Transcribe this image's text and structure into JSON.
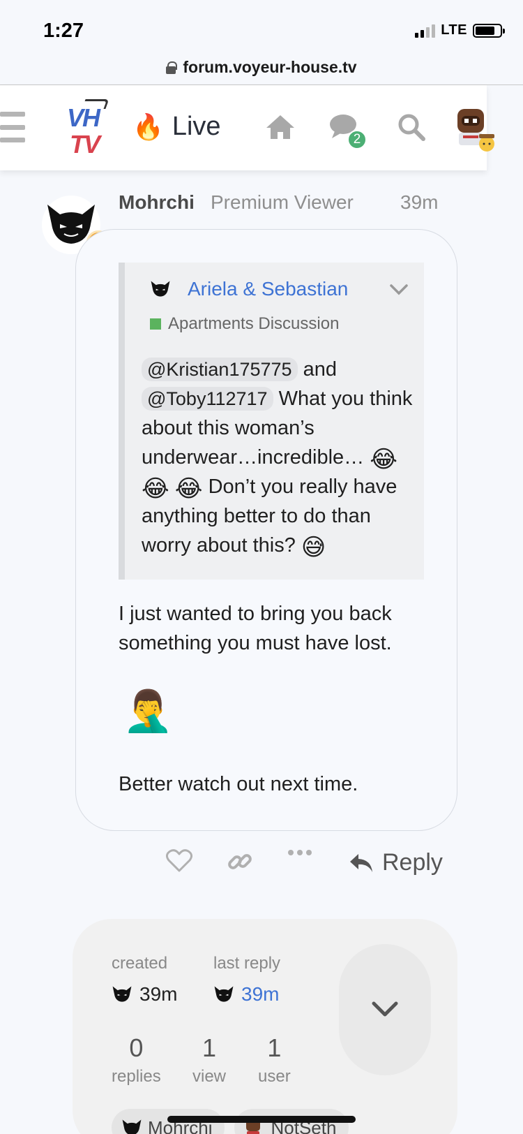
{
  "status_bar": {
    "time": "1:27",
    "network": "LTE"
  },
  "browser": {
    "url": "forum.voyeur-house.tv"
  },
  "header": {
    "logo_top": "VH",
    "logo_bottom": "TV",
    "live_label": "Live",
    "notification_count": "2",
    "icons": [
      "hamburger-icon",
      "home-icon",
      "chat-icon",
      "search-icon"
    ]
  },
  "post": {
    "username": "Mohrchi",
    "user_title": "Premium Viewer",
    "time": "39m",
    "quote": {
      "user": "Ariela & Sebastian",
      "category": "Apartments Discussion",
      "category_color": "#5bb35e",
      "mention_1": "@Kristian175775",
      "and": "and",
      "mention_2": "@Toby112717",
      "text_1": "What you think about this woman’s underwear…incredible…",
      "text_2": "Don’t you really have anything better to do than worry about this?"
    },
    "paragraph_1": "I just wanted to bring you back something you must have lost.",
    "paragraph_2": "Better watch out next time.",
    "actions": {
      "reply_label": "Reply"
    }
  },
  "summary": {
    "created_label": "created",
    "created_time": "39m",
    "last_reply_label": "last reply",
    "last_reply_time": "39m",
    "stats": [
      {
        "value": "0",
        "label": "replies"
      },
      {
        "value": "1",
        "label": "view"
      },
      {
        "value": "1",
        "label": "user"
      }
    ],
    "participants": [
      "Mohrchi",
      "NotSeth"
    ]
  },
  "colors": {
    "accent": "#3e73d4",
    "badge": "#4caf74",
    "brand_red": "#d9434e",
    "brand_blue": "#3d67c6"
  }
}
